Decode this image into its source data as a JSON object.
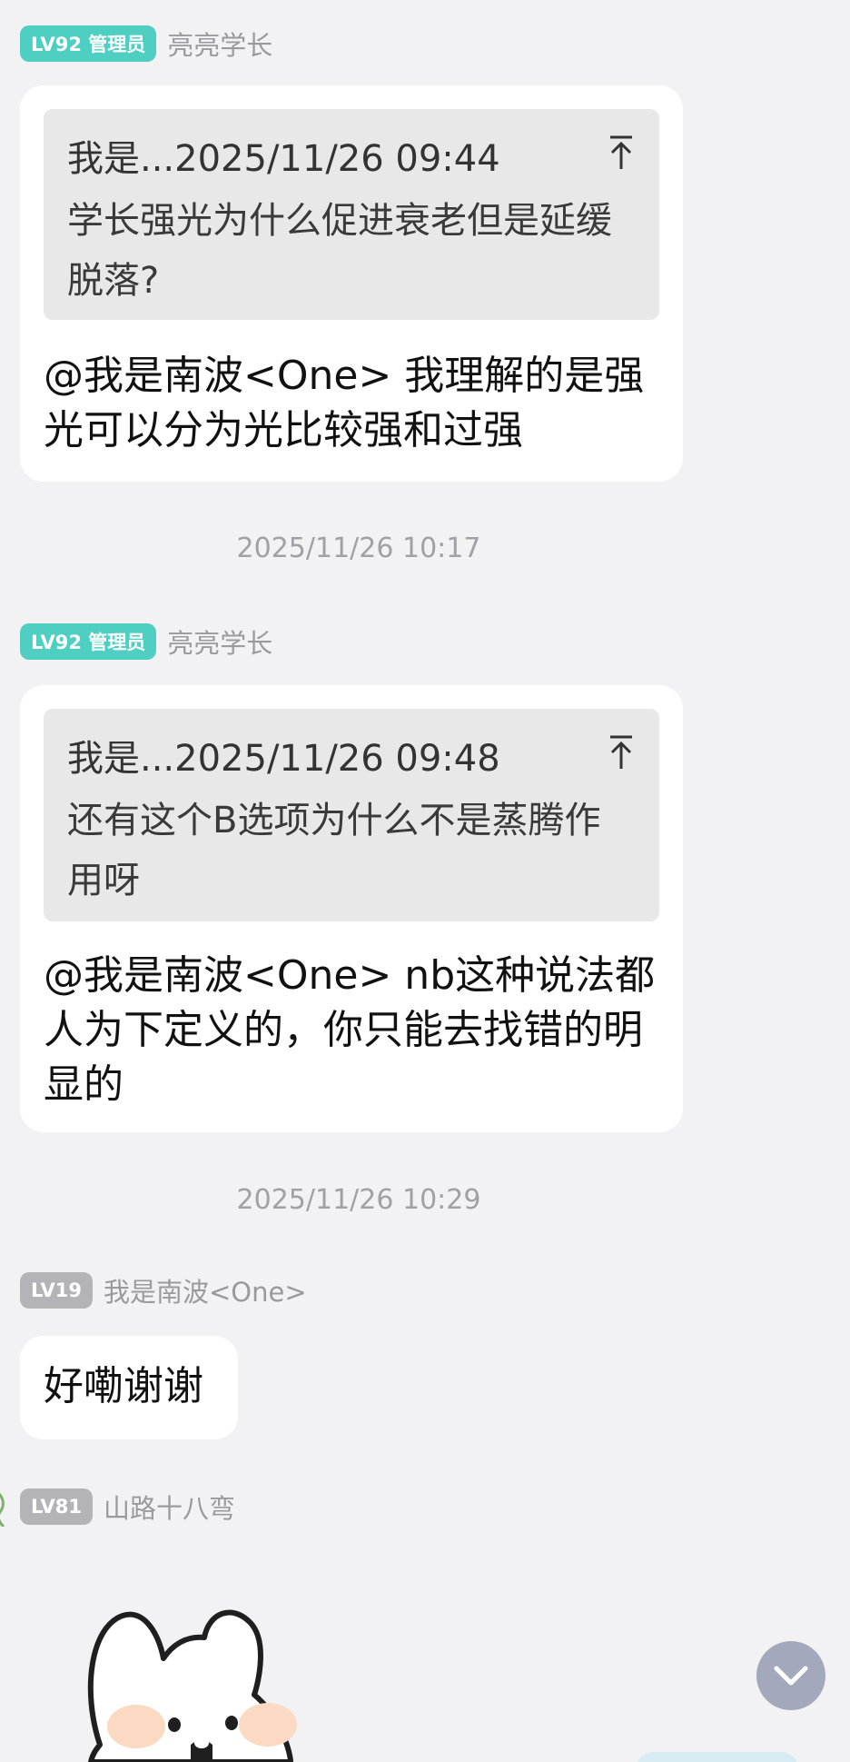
{
  "messages": [
    {
      "sender": {
        "badge": "LV92 管理员",
        "name": "亮亮学长"
      },
      "quote": {
        "header": "我是...2025/11/26 09:44",
        "text": "学长强光为什么促进衰老但是延缓脱落?"
      },
      "text": "@我是南波<One> 我理解的是强光可以分为光比较强和过强"
    },
    {
      "timestamp": "2025/11/26 10:17",
      "sender": {
        "badge": "LV92 管理员",
        "name": "亮亮学长"
      },
      "quote": {
        "header": "我是...2025/11/26 09:48",
        "text": "还有这个B选项为什么不是蒸腾作用呀"
      },
      "text": "@我是南波<One> nb这种说法都人为下定义的，你只能去找错的明显的"
    },
    {
      "timestamp": "2025/11/26 10:29",
      "sender": {
        "badge": "LV19",
        "name": "我是南波<One>"
      },
      "text": "好嘞谢谢"
    },
    {
      "sender": {
        "badge": "LV81",
        "name": "山路十八弯"
      },
      "sticker": "bunny-sticker"
    }
  ],
  "icons": {
    "quote_jump": "arrow-up-to-top-icon",
    "scroll_down": "chevron-down-icon"
  },
  "colors": {
    "background": "#f2f2f5",
    "admin_badge": "#4ecfc1",
    "level_badge": "#b4b4b8",
    "bubble": "#ffffff",
    "quote_box": "#e8e8e8",
    "scroll_button": "#a3a8bd"
  }
}
